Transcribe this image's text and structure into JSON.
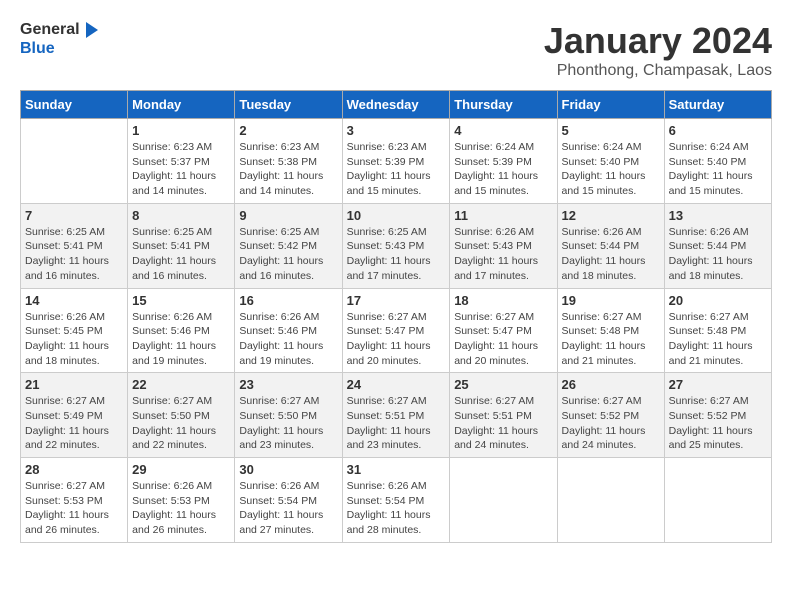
{
  "header": {
    "logo_general": "General",
    "logo_blue": "Blue",
    "month_title": "January 2024",
    "location": "Phonthong, Champasak, Laos"
  },
  "weekdays": [
    "Sunday",
    "Monday",
    "Tuesday",
    "Wednesday",
    "Thursday",
    "Friday",
    "Saturday"
  ],
  "weeks": [
    [
      {
        "day": "",
        "sunrise": "",
        "sunset": "",
        "daylight": ""
      },
      {
        "day": "1",
        "sunrise": "Sunrise: 6:23 AM",
        "sunset": "Sunset: 5:37 PM",
        "daylight": "Daylight: 11 hours and 14 minutes."
      },
      {
        "day": "2",
        "sunrise": "Sunrise: 6:23 AM",
        "sunset": "Sunset: 5:38 PM",
        "daylight": "Daylight: 11 hours and 14 minutes."
      },
      {
        "day": "3",
        "sunrise": "Sunrise: 6:23 AM",
        "sunset": "Sunset: 5:39 PM",
        "daylight": "Daylight: 11 hours and 15 minutes."
      },
      {
        "day": "4",
        "sunrise": "Sunrise: 6:24 AM",
        "sunset": "Sunset: 5:39 PM",
        "daylight": "Daylight: 11 hours and 15 minutes."
      },
      {
        "day": "5",
        "sunrise": "Sunrise: 6:24 AM",
        "sunset": "Sunset: 5:40 PM",
        "daylight": "Daylight: 11 hours and 15 minutes."
      },
      {
        "day": "6",
        "sunrise": "Sunrise: 6:24 AM",
        "sunset": "Sunset: 5:40 PM",
        "daylight": "Daylight: 11 hours and 15 minutes."
      }
    ],
    [
      {
        "day": "7",
        "sunrise": "Sunrise: 6:25 AM",
        "sunset": "Sunset: 5:41 PM",
        "daylight": "Daylight: 11 hours and 16 minutes."
      },
      {
        "day": "8",
        "sunrise": "Sunrise: 6:25 AM",
        "sunset": "Sunset: 5:41 PM",
        "daylight": "Daylight: 11 hours and 16 minutes."
      },
      {
        "day": "9",
        "sunrise": "Sunrise: 6:25 AM",
        "sunset": "Sunset: 5:42 PM",
        "daylight": "Daylight: 11 hours and 16 minutes."
      },
      {
        "day": "10",
        "sunrise": "Sunrise: 6:25 AM",
        "sunset": "Sunset: 5:43 PM",
        "daylight": "Daylight: 11 hours and 17 minutes."
      },
      {
        "day": "11",
        "sunrise": "Sunrise: 6:26 AM",
        "sunset": "Sunset: 5:43 PM",
        "daylight": "Daylight: 11 hours and 17 minutes."
      },
      {
        "day": "12",
        "sunrise": "Sunrise: 6:26 AM",
        "sunset": "Sunset: 5:44 PM",
        "daylight": "Daylight: 11 hours and 18 minutes."
      },
      {
        "day": "13",
        "sunrise": "Sunrise: 6:26 AM",
        "sunset": "Sunset: 5:44 PM",
        "daylight": "Daylight: 11 hours and 18 minutes."
      }
    ],
    [
      {
        "day": "14",
        "sunrise": "Sunrise: 6:26 AM",
        "sunset": "Sunset: 5:45 PM",
        "daylight": "Daylight: 11 hours and 18 minutes."
      },
      {
        "day": "15",
        "sunrise": "Sunrise: 6:26 AM",
        "sunset": "Sunset: 5:46 PM",
        "daylight": "Daylight: 11 hours and 19 minutes."
      },
      {
        "day": "16",
        "sunrise": "Sunrise: 6:26 AM",
        "sunset": "Sunset: 5:46 PM",
        "daylight": "Daylight: 11 hours and 19 minutes."
      },
      {
        "day": "17",
        "sunrise": "Sunrise: 6:27 AM",
        "sunset": "Sunset: 5:47 PM",
        "daylight": "Daylight: 11 hours and 20 minutes."
      },
      {
        "day": "18",
        "sunrise": "Sunrise: 6:27 AM",
        "sunset": "Sunset: 5:47 PM",
        "daylight": "Daylight: 11 hours and 20 minutes."
      },
      {
        "day": "19",
        "sunrise": "Sunrise: 6:27 AM",
        "sunset": "Sunset: 5:48 PM",
        "daylight": "Daylight: 11 hours and 21 minutes."
      },
      {
        "day": "20",
        "sunrise": "Sunrise: 6:27 AM",
        "sunset": "Sunset: 5:48 PM",
        "daylight": "Daylight: 11 hours and 21 minutes."
      }
    ],
    [
      {
        "day": "21",
        "sunrise": "Sunrise: 6:27 AM",
        "sunset": "Sunset: 5:49 PM",
        "daylight": "Daylight: 11 hours and 22 minutes."
      },
      {
        "day": "22",
        "sunrise": "Sunrise: 6:27 AM",
        "sunset": "Sunset: 5:50 PM",
        "daylight": "Daylight: 11 hours and 22 minutes."
      },
      {
        "day": "23",
        "sunrise": "Sunrise: 6:27 AM",
        "sunset": "Sunset: 5:50 PM",
        "daylight": "Daylight: 11 hours and 23 minutes."
      },
      {
        "day": "24",
        "sunrise": "Sunrise: 6:27 AM",
        "sunset": "Sunset: 5:51 PM",
        "daylight": "Daylight: 11 hours and 23 minutes."
      },
      {
        "day": "25",
        "sunrise": "Sunrise: 6:27 AM",
        "sunset": "Sunset: 5:51 PM",
        "daylight": "Daylight: 11 hours and 24 minutes."
      },
      {
        "day": "26",
        "sunrise": "Sunrise: 6:27 AM",
        "sunset": "Sunset: 5:52 PM",
        "daylight": "Daylight: 11 hours and 24 minutes."
      },
      {
        "day": "27",
        "sunrise": "Sunrise: 6:27 AM",
        "sunset": "Sunset: 5:52 PM",
        "daylight": "Daylight: 11 hours and 25 minutes."
      }
    ],
    [
      {
        "day": "28",
        "sunrise": "Sunrise: 6:27 AM",
        "sunset": "Sunset: 5:53 PM",
        "daylight": "Daylight: 11 hours and 26 minutes."
      },
      {
        "day": "29",
        "sunrise": "Sunrise: 6:26 AM",
        "sunset": "Sunset: 5:53 PM",
        "daylight": "Daylight: 11 hours and 26 minutes."
      },
      {
        "day": "30",
        "sunrise": "Sunrise: 6:26 AM",
        "sunset": "Sunset: 5:54 PM",
        "daylight": "Daylight: 11 hours and 27 minutes."
      },
      {
        "day": "31",
        "sunrise": "Sunrise: 6:26 AM",
        "sunset": "Sunset: 5:54 PM",
        "daylight": "Daylight: 11 hours and 28 minutes."
      },
      {
        "day": "",
        "sunrise": "",
        "sunset": "",
        "daylight": ""
      },
      {
        "day": "",
        "sunrise": "",
        "sunset": "",
        "daylight": ""
      },
      {
        "day": "",
        "sunrise": "",
        "sunset": "",
        "daylight": ""
      }
    ]
  ]
}
